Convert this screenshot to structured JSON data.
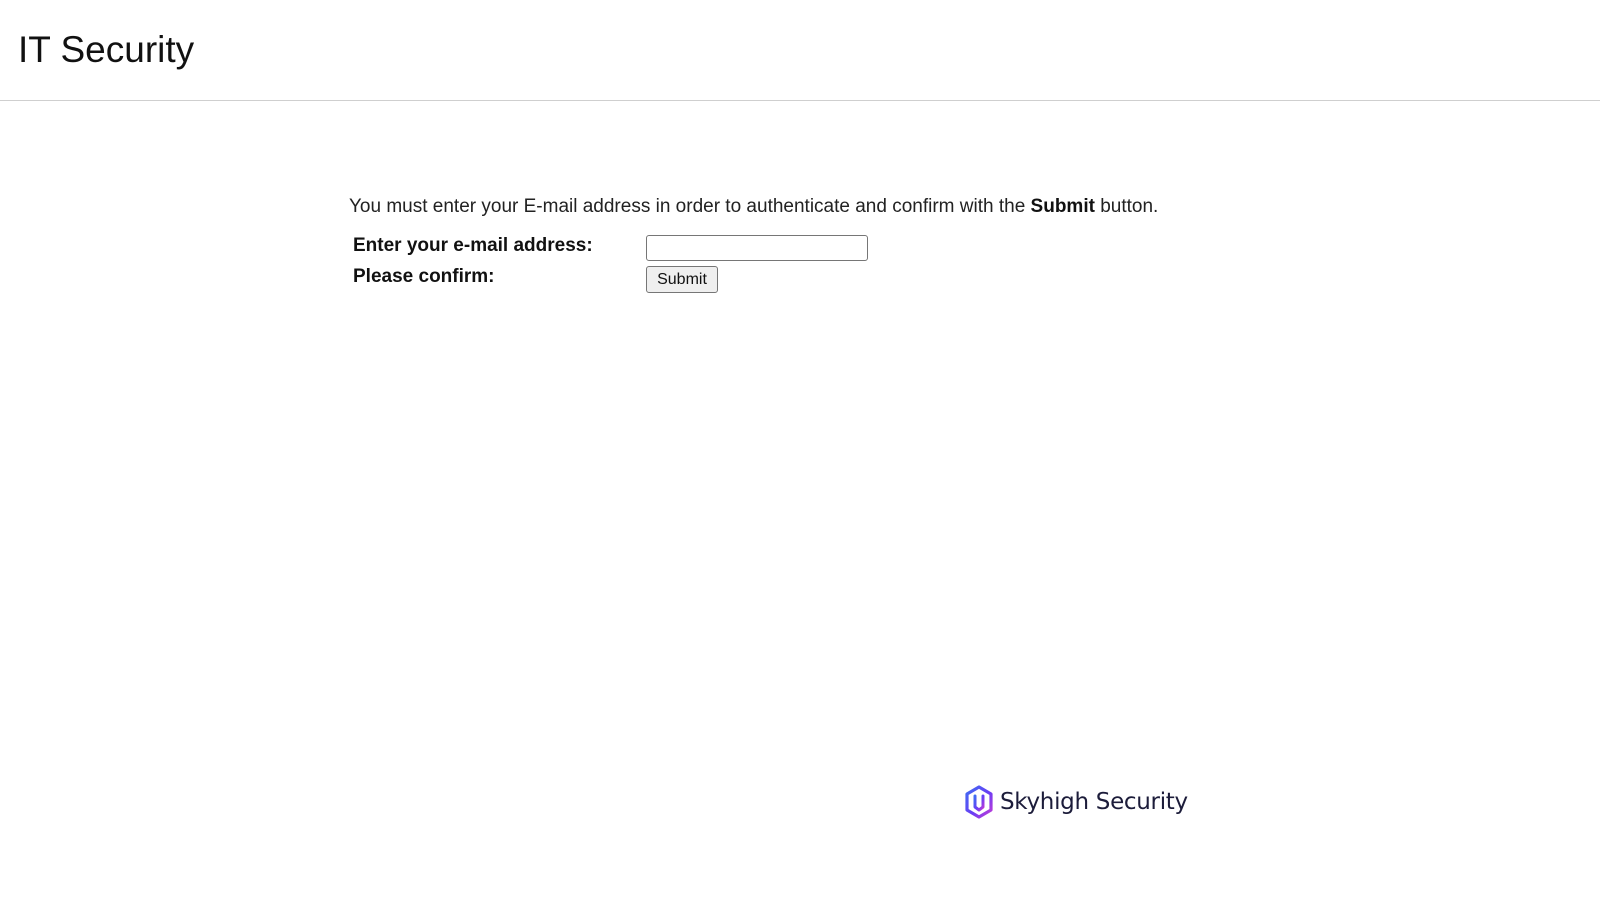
{
  "header": {
    "title": "IT Security"
  },
  "instruction": {
    "prefix": "You must enter your E-mail address in order to authenticate and confirm with the ",
    "emphasis": "Submit",
    "suffix": " button."
  },
  "form": {
    "email_label": "Enter your e-mail address:",
    "email_value": "",
    "confirm_label": "Please confirm:",
    "submit_label": "Submit"
  },
  "footer": {
    "brand_name": "Skyhigh Security",
    "brand_icon": "skyhigh-shield-logo-icon",
    "brand_colors": [
      "#6a3df5",
      "#c23cd6",
      "#3f6cf2"
    ]
  }
}
